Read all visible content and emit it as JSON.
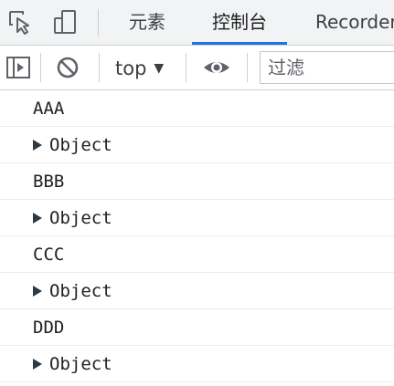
{
  "tabbar": {
    "tabs": [
      {
        "label": "元素",
        "active": false
      },
      {
        "label": "控制台",
        "active": true
      },
      {
        "label": "Recorder",
        "active": false
      }
    ],
    "accent_color": "#1a73e8"
  },
  "toolbar": {
    "context": "top",
    "filter_placeholder": "过滤"
  },
  "console": {
    "messages": [
      {
        "type": "text",
        "text": "AAA"
      },
      {
        "type": "object",
        "text": "Object"
      },
      {
        "type": "text",
        "text": "BBB"
      },
      {
        "type": "object",
        "text": "Object"
      },
      {
        "type": "text",
        "text": "CCC"
      },
      {
        "type": "object",
        "text": "Object"
      },
      {
        "type": "text",
        "text": "DDD"
      },
      {
        "type": "object",
        "text": "Object"
      }
    ]
  }
}
